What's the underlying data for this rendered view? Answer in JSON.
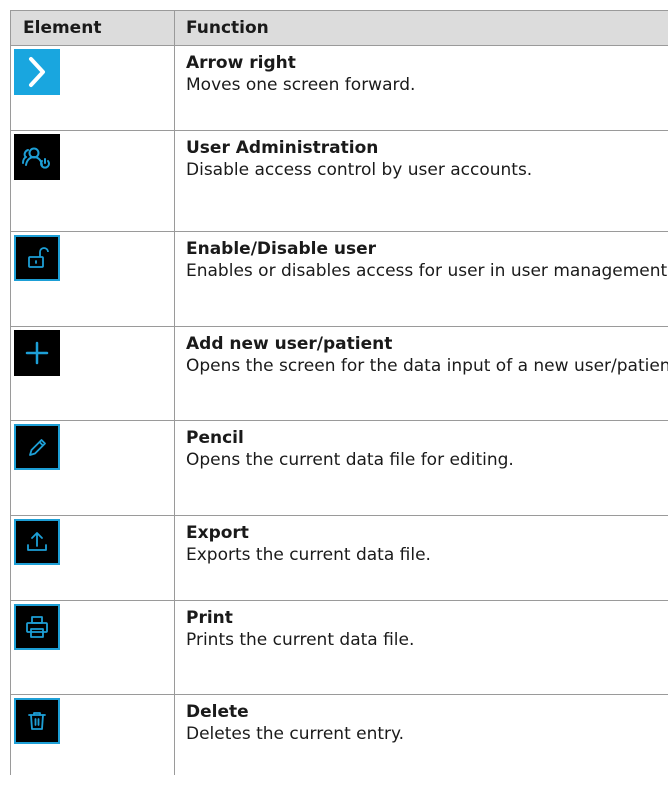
{
  "headers": {
    "element": "Element",
    "function": "Function"
  },
  "accent_color": "#1d9fd6",
  "rows": [
    {
      "icon": "arrow-right-icon",
      "title": "Arrow right",
      "desc": "Moves one screen forward."
    },
    {
      "icon": "user-administration-icon",
      "title": "User Administration",
      "desc": "Disable access control by user accounts."
    },
    {
      "icon": "unlock-icon",
      "title": "Enable/Disable user",
      "desc": "Enables or disables access for user in user management."
    },
    {
      "icon": "plus-icon",
      "title": "Add new user/patient",
      "desc": "Opens the screen for the data input of a new user/patient."
    },
    {
      "icon": "pencil-icon",
      "title": "Pencil",
      "desc": "Opens the current data file for editing."
    },
    {
      "icon": "export-icon",
      "title": "Export",
      "desc": "Exports the current data file."
    },
    {
      "icon": "printer-icon",
      "title": "Print",
      "desc": "Prints the current data file."
    },
    {
      "icon": "trash-icon",
      "title": "Delete",
      "desc": "Deletes the current entry."
    }
  ]
}
